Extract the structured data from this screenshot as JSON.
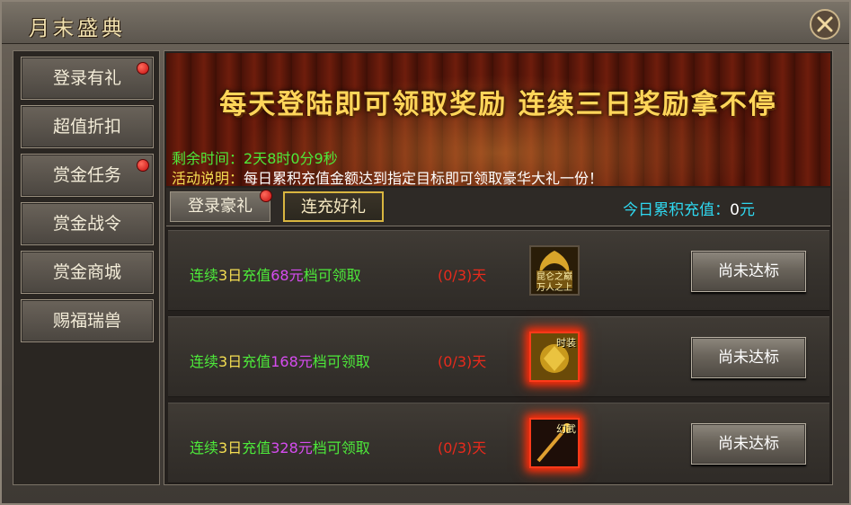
{
  "window": {
    "title": "月末盛典"
  },
  "sidebar": {
    "items": [
      {
        "label": "登录有礼",
        "has_dot": true
      },
      {
        "label": "超值折扣",
        "has_dot": false
      },
      {
        "label": "赏金任务",
        "has_dot": true
      },
      {
        "label": "赏金战令",
        "has_dot": false
      },
      {
        "label": "赏金商城",
        "has_dot": false
      },
      {
        "label": "赐福瑞兽",
        "has_dot": false
      }
    ]
  },
  "banner": {
    "slogan": "每天登陆即可领取奖励 连续三日奖励拿不停",
    "time_label": "剩余时间：",
    "time_value": "2天8时0分9秒",
    "desc_label": "活动说明：",
    "desc_value": "每日累积充值金额达到指定目标即可领取豪华大礼一份！"
  },
  "tabs": [
    {
      "label": "登录豪礼",
      "active": false,
      "has_dot": true
    },
    {
      "label": "连充好礼",
      "active": true,
      "has_dot": false
    }
  ],
  "today_total": {
    "label": "今日累积充值：",
    "value": "0",
    "unit": "元"
  },
  "rows": [
    {
      "prefix": "连续",
      "days": "3日",
      "mid": "充值",
      "amount": "68元",
      "suffix": "档可领取",
      "progress_open": "(",
      "progress_value": "0/3",
      "progress_close": ")天",
      "item_icon": "gold-title-plaque-icon",
      "item_label": "昆仑之巅 万人之上",
      "item_glow": false,
      "button": "尚未达标"
    },
    {
      "prefix": "连续",
      "days": "3日",
      "mid": "充值",
      "amount": "168元",
      "suffix": "档可领取",
      "progress_open": "(",
      "progress_value": "0/3",
      "progress_close": ")天",
      "item_icon": "golden-fashion-armor-icon",
      "item_label": "时装",
      "item_glow": true,
      "button": "尚未达标"
    },
    {
      "prefix": "连续",
      "days": "3日",
      "mid": "充值",
      "amount": "328元",
      "suffix": "档可领取",
      "progress_open": "(",
      "progress_value": "0/3",
      "progress_close": ")天",
      "item_icon": "phantom-weapon-staff-icon",
      "item_label": "幻武",
      "item_glow": true,
      "button": "尚未达标"
    }
  ],
  "colors": {
    "green": "#4dea3a",
    "yellow": "#f4de52",
    "purple": "#d64cf0",
    "red": "#e82a1c",
    "cyan": "#2fd8f0",
    "gold": "#ffd65a"
  }
}
